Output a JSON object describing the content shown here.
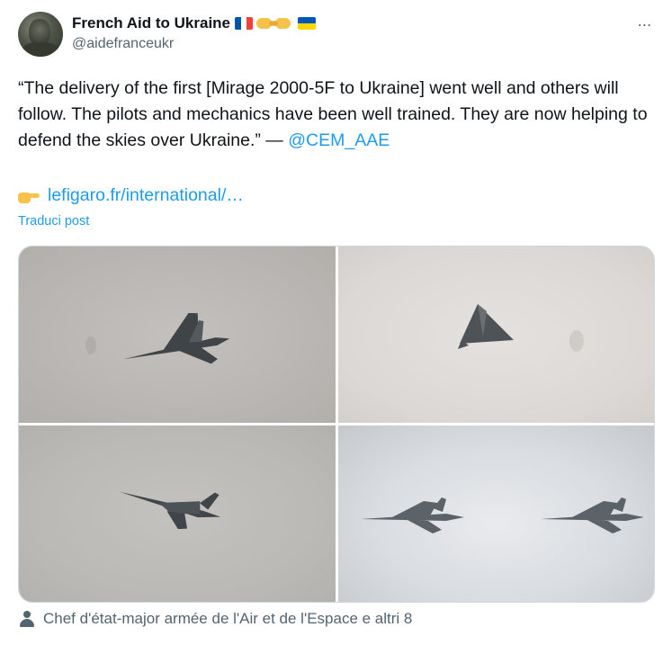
{
  "author": {
    "display_name": "French Aid to Ukraine",
    "handle": "@aidefranceukr",
    "badges": [
      "france-flag-icon",
      "fist-bump-icon",
      "ukraine-flag-icon"
    ]
  },
  "more_icon": "⋯",
  "tweet": {
    "text_before": "“The delivery of the first [Mirage 2000-5F to Ukraine] went well and others will follow. The pilots and mechanics have been well trained. They are now helping to defend the skies over Ukraine.” — ",
    "mention": "@CEM_AAE",
    "link_icon": "pointing-hand-icon",
    "link_text": "lefigaro.fr/international/…",
    "translate_label": "Traduci post"
  },
  "media": {
    "photos": [
      "mirage-jet-photo-1",
      "mirage-jet-photo-2",
      "mirage-jet-photo-3",
      "mirage-jets-pair-photo"
    ]
  },
  "footer": {
    "tagged_text": "Chef d'état-major armée de l'Air et de l'Espace e altri 8"
  },
  "colors": {
    "accent": "#1d9bf0",
    "secondary_text": "#536471",
    "primary_text": "#0f1419",
    "border": "#cfd9de",
    "france_blue": "#0055a4",
    "france_red": "#ef4135",
    "ukraine_blue": "#0057b7",
    "ukraine_yellow": "#ffd700"
  }
}
